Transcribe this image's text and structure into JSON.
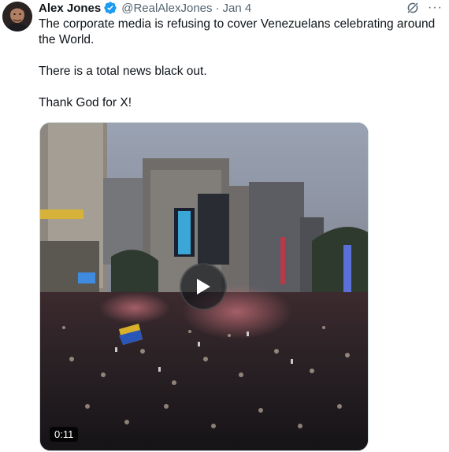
{
  "author": {
    "name": "Alex Jones",
    "handle": "@RealAlexJones",
    "separator": "·",
    "date": "Jan 4",
    "verified_color": "#1d9bf0"
  },
  "icons": {
    "grok": "grok-icon",
    "more": "more-icon",
    "more_glyph": "···",
    "play": "play-icon",
    "verified": "verified-badge-icon"
  },
  "tweet": {
    "paragraphs": [
      "The corporate media is refusing to cover Venezuelans celebrating around the World.",
      "There is a total news black out.",
      "Thank God for X!"
    ]
  },
  "media": {
    "type": "video",
    "duration": "0:11"
  },
  "colors": {
    "text": "#0f1419",
    "secondary": "#536471",
    "border": "#cfd9de"
  }
}
